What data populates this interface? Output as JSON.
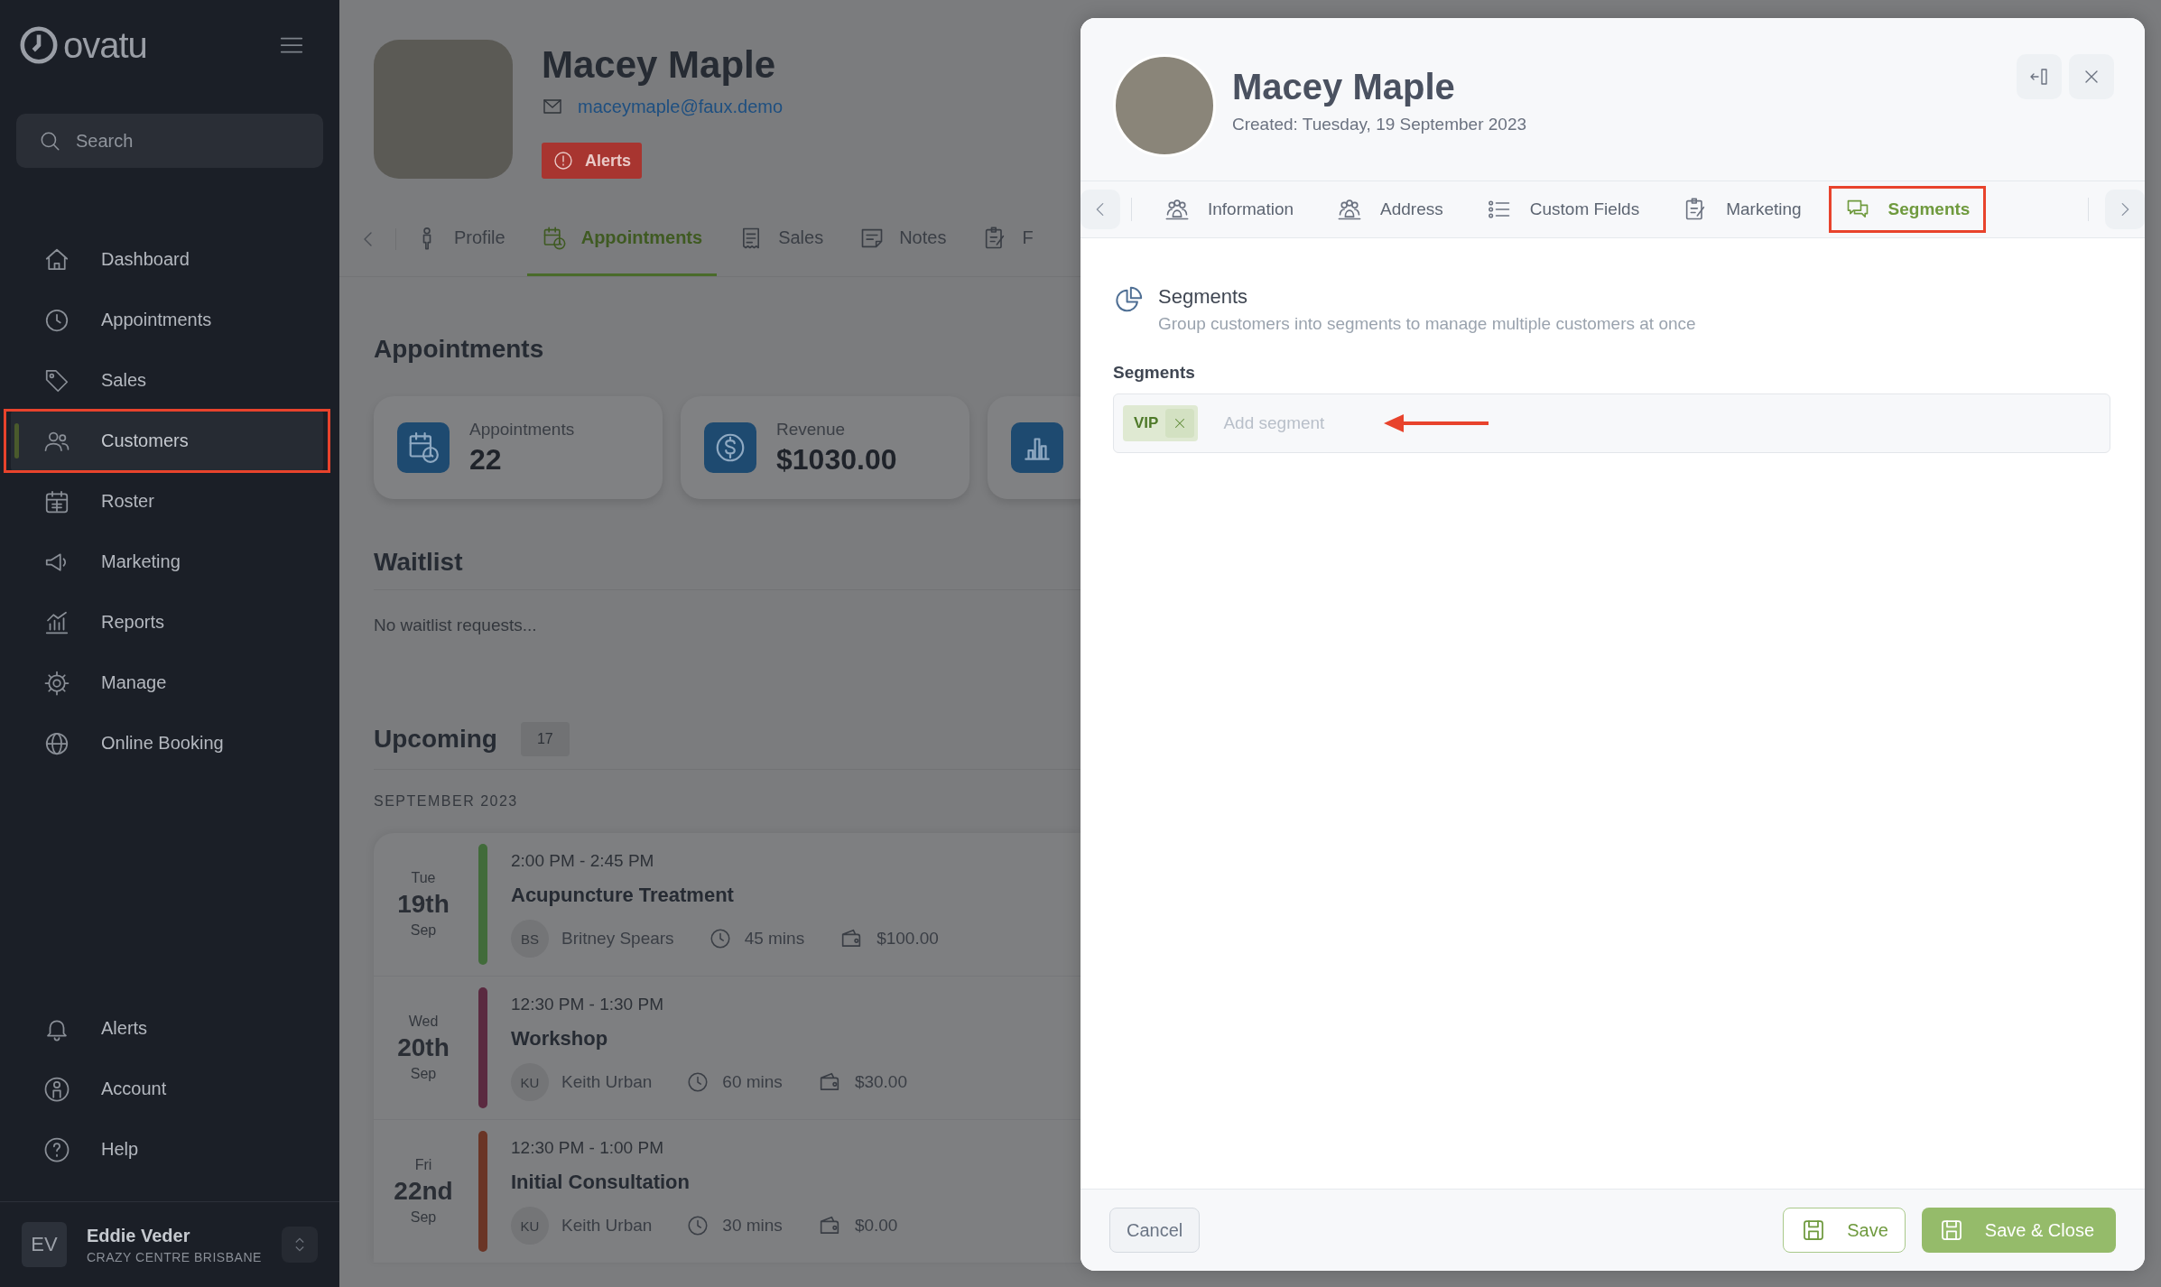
{
  "sidebar": {
    "logo": "ovatu",
    "search": {
      "placeholder": "Search"
    },
    "items": [
      {
        "label": "Dashboard",
        "selected": false,
        "highlighted": false
      },
      {
        "label": "Appointments",
        "selected": false,
        "highlighted": false
      },
      {
        "label": "Sales",
        "selected": false,
        "highlighted": false
      },
      {
        "label": "Customers",
        "selected": true,
        "highlighted": true
      },
      {
        "label": "Roster",
        "selected": false,
        "highlighted": false
      },
      {
        "label": "Marketing",
        "selected": false,
        "highlighted": false
      },
      {
        "label": "Reports",
        "selected": false,
        "highlighted": false
      },
      {
        "label": "Manage",
        "selected": false,
        "highlighted": false
      },
      {
        "label": "Online Booking",
        "selected": false,
        "highlighted": false
      }
    ],
    "bottom_items": [
      {
        "label": "Alerts",
        "selected": false
      },
      {
        "label": "Account",
        "selected": false
      },
      {
        "label": "Help",
        "selected": false
      }
    ],
    "user": {
      "initials": "EV",
      "name": "Eddie Veder",
      "location": "CRAZY CENTRE BRISBANE"
    }
  },
  "customer": {
    "name": "Macey Maple",
    "email": "maceymaple@faux.demo",
    "alerts_button": "Alerts"
  },
  "tabs": [
    {
      "label": "Profile",
      "selected": false
    },
    {
      "label": "Appointments",
      "selected": true
    },
    {
      "label": "Sales",
      "selected": false
    },
    {
      "label": "Notes",
      "selected": false
    },
    {
      "label": "F",
      "selected": false
    }
  ],
  "appointments": {
    "title": "Appointments",
    "stats": [
      {
        "label": "Appointments",
        "value": "22"
      },
      {
        "label": "Revenue",
        "value": "$1030.00"
      }
    ]
  },
  "waitlist": {
    "title": "Waitlist",
    "empty_text": "No waitlist requests..."
  },
  "upcoming": {
    "title": "Upcoming",
    "count": "17",
    "month": "SEPTEMBER 2023",
    "items": [
      {
        "weekday": "Tue",
        "day": "19th",
        "month": "Sep",
        "color": "#416b3a",
        "time": "2:00 PM - 2:45 PM",
        "title": "Acupuncture Treatment",
        "initials": "BS",
        "staff": "Britney Spears",
        "duration": "45 mins",
        "price": "$100.00"
      },
      {
        "weekday": "Wed",
        "day": "20th",
        "month": "Sep",
        "color": "#5a2a40",
        "time": "12:30 PM - 1:30 PM",
        "title": "Workshop",
        "initials": "KU",
        "staff": "Keith Urban",
        "duration": "60 mins",
        "price": "$30.00"
      },
      {
        "weekday": "Fri",
        "day": "22nd",
        "month": "Sep",
        "color": "#6a3526",
        "time": "12:30 PM - 1:00 PM",
        "title": "Initial Consultation",
        "initials": "KU",
        "staff": "Keith Urban",
        "duration": "30 mins",
        "price": "$0.00"
      }
    ]
  },
  "drawer": {
    "name": "Macey Maple",
    "created": "Created: Tuesday, 19 September 2023",
    "tabs": [
      {
        "label": "Information",
        "selected": false,
        "highlighted": false
      },
      {
        "label": "Address",
        "selected": false,
        "highlighted": false
      },
      {
        "label": "Custom Fields",
        "selected": false,
        "highlighted": false
      },
      {
        "label": "Marketing",
        "selected": false,
        "highlighted": false
      },
      {
        "label": "Segments",
        "selected": true,
        "highlighted": true
      }
    ],
    "section": {
      "title": "Segments",
      "description": "Group customers into segments to manage multiple customers at once"
    },
    "field": {
      "label": "Segments",
      "chips": [
        {
          "label": "VIP"
        }
      ],
      "placeholder": "Add segment",
      "pointer_arrow": true
    },
    "buttons": {
      "cancel": "Cancel",
      "save": "Save",
      "save_close": "Save & Close"
    }
  }
}
